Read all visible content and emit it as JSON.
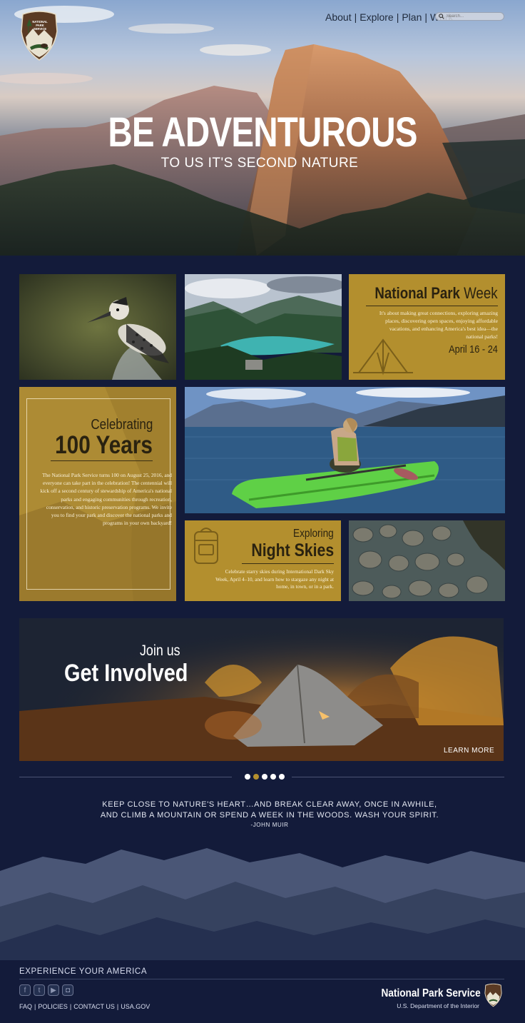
{
  "nav": {
    "items": [
      {
        "label": "About"
      },
      {
        "label": "Explore"
      },
      {
        "label": "Plan"
      },
      {
        "label": "Work"
      }
    ],
    "search_placeholder": "Search..."
  },
  "logo": {
    "icon": "nps-arrowhead-logo",
    "text": "NATIONAL PARK SERVICE"
  },
  "hero": {
    "title": "BE ADVENTUROUS",
    "subtitle": "TO US IT'S SECOND NATURE"
  },
  "npw": {
    "title_bold": "National Park",
    "title_light": "Week",
    "body": "It's about making great connections, exploring amazing places, discovering open spaces, enjoying affordable vacations, and enhancing America's best idea—the national parks!",
    "date": "April 16 - 24",
    "icon": "tent-outline-icon"
  },
  "celebrating": {
    "small": "Celebrating",
    "big": "100 Years",
    "body": "The National Park Service turns 100 on August 25, 2016, and everyone can take part in the celebration! The centennial will kick off a second century of stewardship of America's national parks and engaging communities through recreation, conservation, and historic preservation programs. We invite you to find your park and discover the national parks and programs in your own backyard!"
  },
  "night_skies": {
    "small": "Exploring",
    "big": "Night Skies",
    "body": "Celebrate starry skies during International Dark Sky Week, April 4–10, and learn how to stargaze any night at home, in town, or in a park.",
    "icon": "backpack-outline-icon"
  },
  "get_involved": {
    "small": "Join us",
    "big": "Get Involved",
    "cta": "LEARN MORE"
  },
  "carousel": {
    "count": 5,
    "active": 1
  },
  "quote": {
    "line1": "KEEP CLOSE TO NATURE'S HEART…AND BREAK CLEAR AWAY, ONCE IN AWHILE,",
    "line2": "AND CLIMB A MOUNTAIN OR SPEND A WEEK IN THE WOODS. WASH YOUR SPIRIT.",
    "author": "-JOHN MUIR"
  },
  "footer": {
    "tagline": "EXPERIENCE YOUR AMERICA",
    "social": [
      {
        "icon": "facebook-icon",
        "glyph": "f"
      },
      {
        "icon": "twitter-icon",
        "glyph": "t"
      },
      {
        "icon": "youtube-icon",
        "glyph": "▶"
      },
      {
        "icon": "instagram-icon",
        "glyph": "◘"
      }
    ],
    "links": [
      {
        "label": "FAQ"
      },
      {
        "label": "POLICIES"
      },
      {
        "label": "CONTACT US"
      },
      {
        "label": "USA.GOV"
      }
    ],
    "org_name": "National Park Service",
    "dept": "U.S. Department of the Interior"
  },
  "colors": {
    "navy": "#131b3a",
    "gold": "#b38f2e",
    "dark_text": "#2a2210"
  }
}
